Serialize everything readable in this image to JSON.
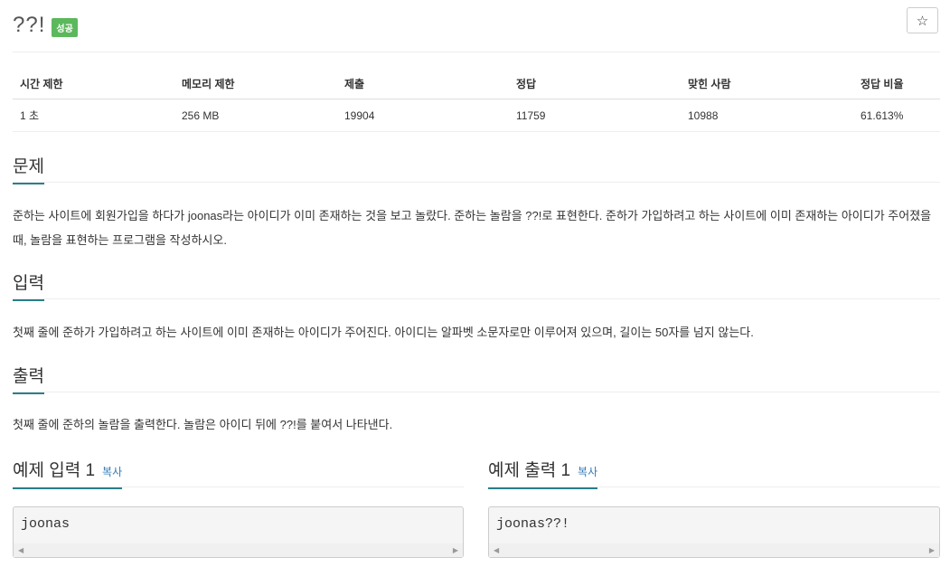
{
  "problem": {
    "title": "??!",
    "badge": "성공",
    "star_icon": "☆"
  },
  "info": {
    "headers": [
      "시간 제한",
      "메모리 제한",
      "제출",
      "정답",
      "맞힌 사람",
      "정답 비율"
    ],
    "values": [
      "1 초",
      "256 MB",
      "19904",
      "11759",
      "10988",
      "61.613%"
    ]
  },
  "sections": {
    "problem": {
      "heading": "문제",
      "text": "준하는 사이트에 회원가입을 하다가 joonas라는 아이디가 이미 존재하는 것을 보고 놀랐다. 준하는 놀람을 ??!로 표현한다. 준하가 가입하려고 하는 사이트에 이미 존재하는 아이디가 주어졌을 때, 놀람을 표현하는 프로그램을 작성하시오."
    },
    "input": {
      "heading": "입력",
      "text": "첫째 줄에 준하가 가입하려고 하는 사이트에 이미 존재하는 아이디가 주어진다. 아이디는 알파벳 소문자로만 이루어져 있으며, 길이는 50자를 넘지 않는다."
    },
    "output": {
      "heading": "출력",
      "text": "첫째 줄에 준하의 놀람을 출력한다. 놀람은 아이디 뒤에 ??!를 붙여서 나타낸다."
    }
  },
  "samples": {
    "input": {
      "heading": "예제 입력 1",
      "copy": "복사",
      "code": "joonas"
    },
    "output": {
      "heading": "예제 출력 1",
      "copy": "복사",
      "code": "joonas??!"
    }
  },
  "colors": {
    "accent": "#2a7f8a",
    "success": "#5cb85c",
    "link": "#337ab7"
  }
}
